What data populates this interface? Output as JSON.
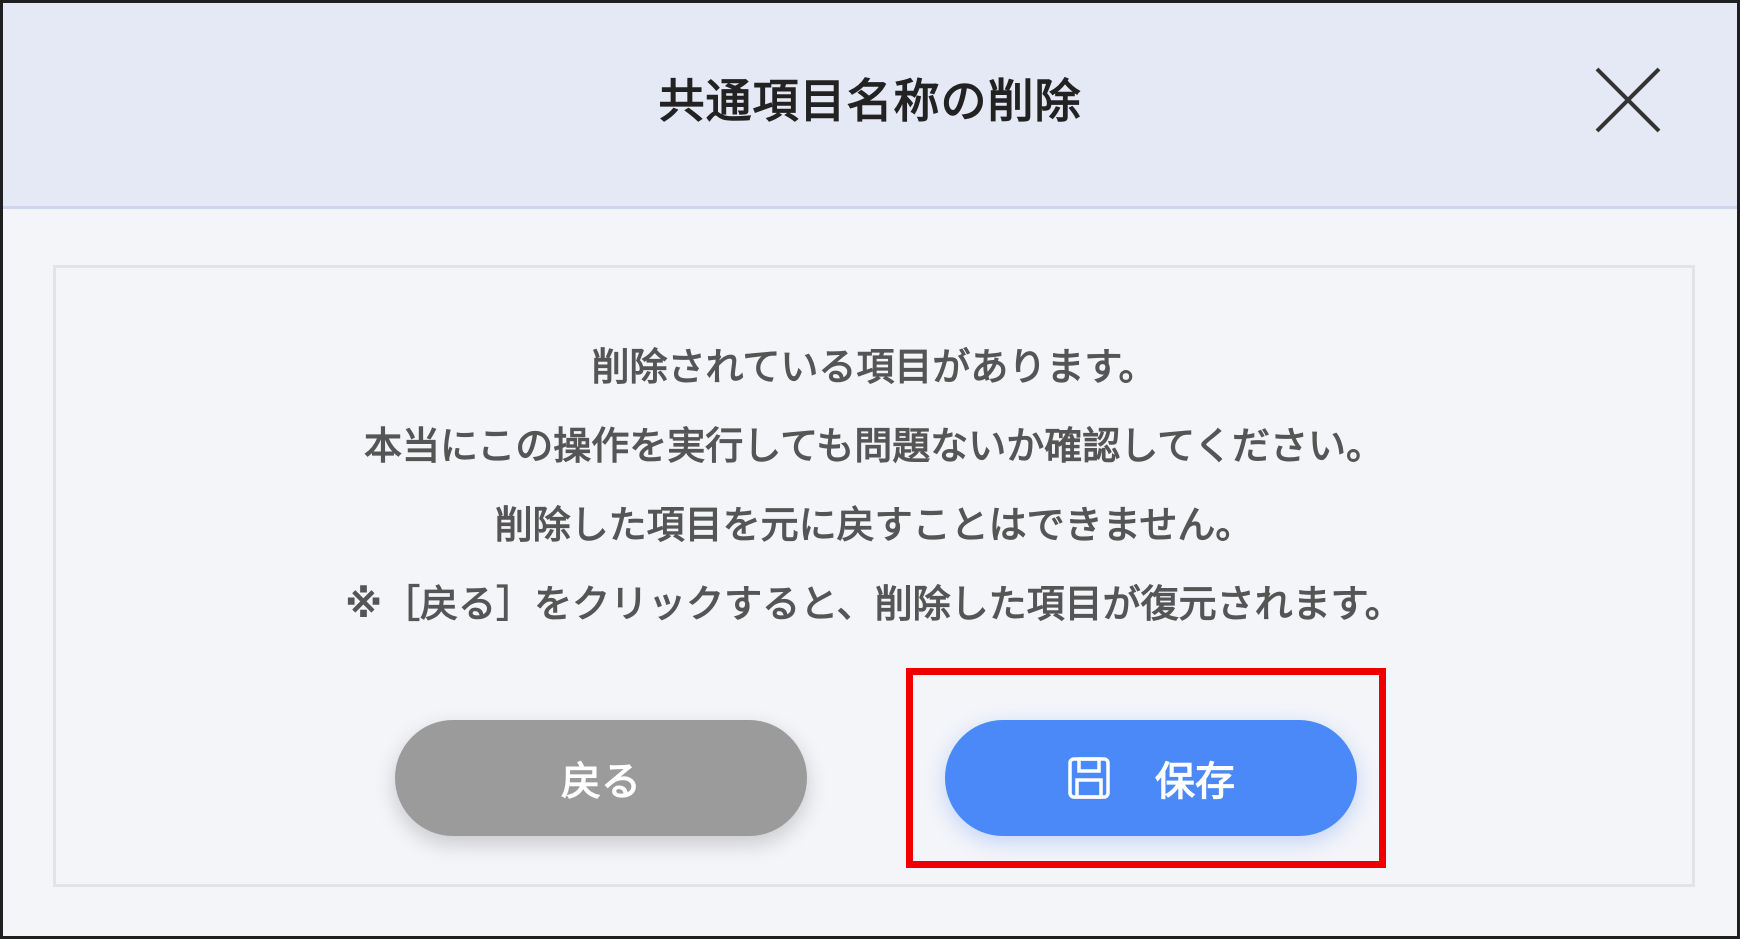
{
  "dialog": {
    "title": "共通項目名称の削除",
    "close_icon": "close-icon"
  },
  "messages": [
    "削除されている項目があります。",
    "本当にこの操作を実行しても問題ないか確認してください。",
    "削除した項目を元に戻すことはできません。",
    "※［戻る］をクリックすると、削除した項目が復元されます。"
  ],
  "buttons": {
    "back_label": "戻る",
    "save_label": "保存",
    "save_icon": "floppy-disk-icon"
  },
  "colors": {
    "header_bg": "#e5e8f5",
    "body_bg": "#f4f5f9",
    "back_button": "#9b9b9b",
    "save_button": "#4a89f7",
    "highlight": "#ee0000"
  }
}
